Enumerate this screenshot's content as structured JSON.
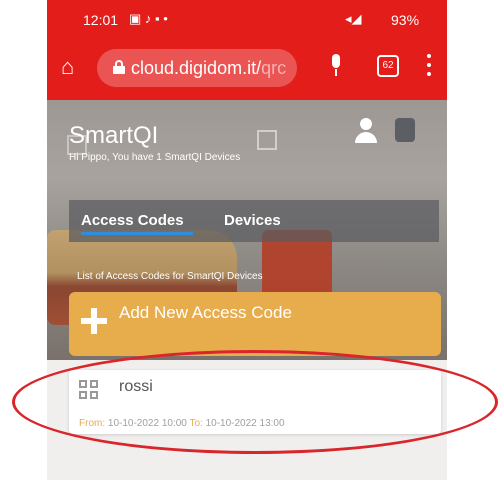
{
  "status_bar": {
    "time": "12:01",
    "battery": "93%"
  },
  "browser": {
    "url_main": "cloud.digidom.it/",
    "url_faded": "qrc",
    "tab_count": "62"
  },
  "app": {
    "brand": "SmartQI",
    "greeting": "Hi Pippo, You have 1 SmartQI Devices",
    "tabs": [
      {
        "label": "Access Codes",
        "active": true
      },
      {
        "label": "Devices",
        "active": false
      }
    ],
    "list_caption": "List of Access Codes for SmartQI Devices",
    "add_button_label": "Add New Access Code",
    "codes": [
      {
        "name": "rossi",
        "from_label": "From:",
        "from": "10-10-2022 10:00",
        "to_label": "To:",
        "to": "10-10-2022 13:00"
      }
    ]
  },
  "colors": {
    "toolbar": "#e31d1a",
    "accent_orange": "#e7ad4d",
    "tab_underline": "#2f8de4",
    "annotation_red": "#d9262a"
  },
  "icons": [
    "home-icon",
    "lock-icon",
    "mic-icon",
    "tabs-icon",
    "menu-icon",
    "user-icon",
    "gear-icon",
    "plus-icon",
    "qr-icon"
  ]
}
